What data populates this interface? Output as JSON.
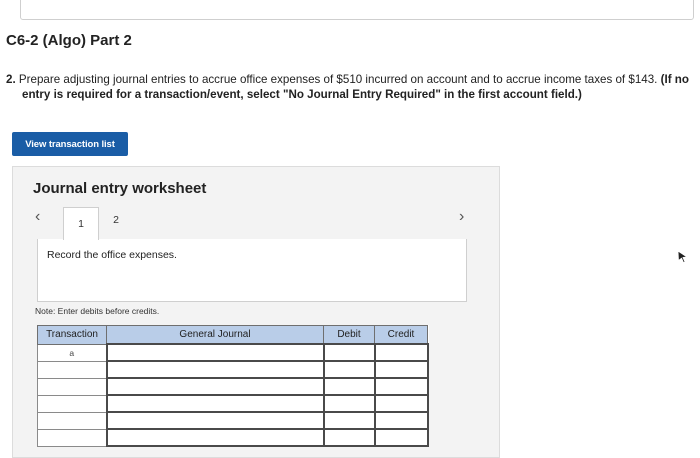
{
  "header": {
    "part_title": "C6-2 (Algo) Part 2"
  },
  "instructions": {
    "number": "2.",
    "text_line1": "Prepare adjusting journal entries to accrue office expenses of $510 incurred on account and to accrue income taxes of $143.",
    "note_line1": "(If no",
    "note_line2": "entry is required for a transaction/event, select \"No Journal Entry Required\" in the first account field.)"
  },
  "buttons": {
    "view_transactions": "View transaction list"
  },
  "worksheet": {
    "title": "Journal entry worksheet",
    "tabs": [
      {
        "label": "1",
        "active": true
      },
      {
        "label": "2",
        "active": false
      }
    ],
    "record_prompt": "Record the office expenses.",
    "note": "Note: Enter debits before credits.",
    "table": {
      "columns": [
        "Transaction",
        "General Journal",
        "Debit",
        "Credit"
      ],
      "rows": [
        {
          "transaction": "a",
          "account": "",
          "debit": "",
          "credit": ""
        },
        {
          "transaction": "",
          "account": "",
          "debit": "",
          "credit": ""
        },
        {
          "transaction": "",
          "account": "",
          "debit": "",
          "credit": ""
        },
        {
          "transaction": "",
          "account": "",
          "debit": "",
          "credit": ""
        },
        {
          "transaction": "",
          "account": "",
          "debit": "",
          "credit": ""
        },
        {
          "transaction": "",
          "account": "",
          "debit": "",
          "credit": ""
        }
      ]
    }
  },
  "icons": {
    "prev": "chevron-left-icon",
    "next": "chevron-right-icon",
    "cursor": "mouse-pointer-icon"
  },
  "colors": {
    "button_bg": "#1a5da6",
    "table_header_bg": "#b9cde8",
    "worksheet_bg": "#f3f3f3"
  }
}
